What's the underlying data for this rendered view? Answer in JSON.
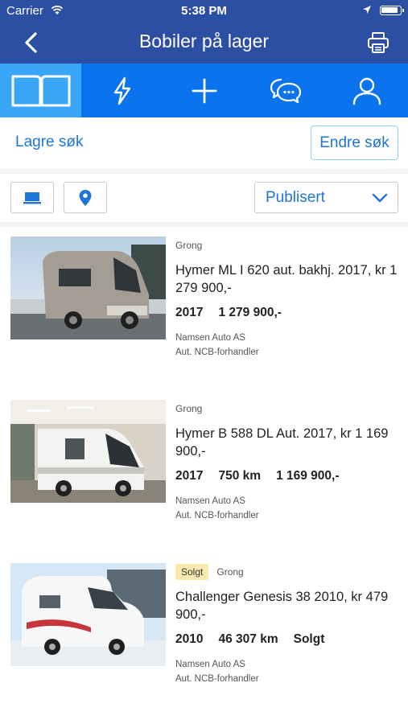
{
  "status_bar": {
    "carrier": "Carrier",
    "time": "5:38 PM"
  },
  "navbar": {
    "title": "Bobiler på lager",
    "back_icon": "chevron-left-icon",
    "print_icon": "printer-icon"
  },
  "tabs": [
    {
      "icon": "book-icon",
      "active": true
    },
    {
      "icon": "lightning-icon",
      "active": false
    },
    {
      "icon": "plus-icon",
      "active": false
    },
    {
      "icon": "chat-bubbles-icon",
      "active": false
    },
    {
      "icon": "user-icon",
      "active": false
    }
  ],
  "actions": {
    "save_search": "Lagre søk",
    "change_search": "Endre søk"
  },
  "filters": {
    "list_view_icon": "laptop-icon",
    "map_icon": "map-pin-icon",
    "sort_label": "Publisert"
  },
  "listings": [
    {
      "badge": "",
      "location": "Grong",
      "title": "Hymer ML I 620 aut. bakhj. 2017, kr 1 279 900,-",
      "year": "2017",
      "km": "",
      "price": "1 279 900,-",
      "dealer": "Namsen Auto AS",
      "dealer_type": "Aut. NCB-forhandler"
    },
    {
      "badge": "",
      "location": "Grong",
      "title": "Hymer B 588 DL Aut. 2017, kr 1 169 900,-",
      "year": "2017",
      "km": "750 km",
      "price": "1 169 900,-",
      "dealer": "Namsen Auto AS",
      "dealer_type": "Aut. NCB-forhandler"
    },
    {
      "badge": "Solgt",
      "location": "Grong",
      "title": "Challenger Genesis 38 2010, kr 479 900,-",
      "year": "2010",
      "km": "46 307 km",
      "price": "Solgt",
      "dealer": "Namsen Auto AS",
      "dealer_type": "Aut. NCB-forhandler"
    }
  ],
  "colors": {
    "navbar": "#2c4fa3",
    "tabbar": "#0a73ed",
    "tab_active": "#3aa6f7",
    "link": "#1d76d6",
    "badge": "#fbeab0"
  }
}
